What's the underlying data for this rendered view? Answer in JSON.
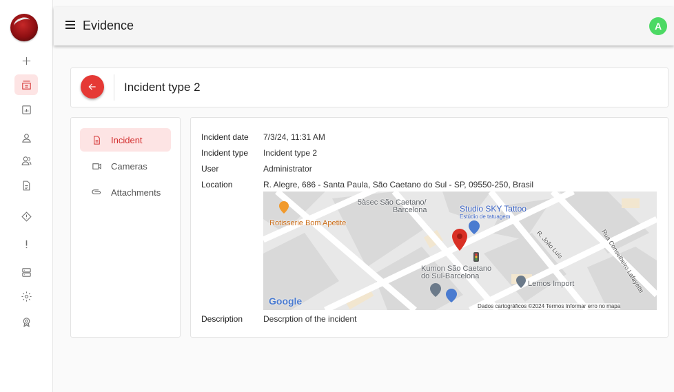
{
  "topbar": {
    "title": "Evidence",
    "avatar_letter": "A"
  },
  "header": {
    "title": "Incident type 2"
  },
  "tabs": [
    {
      "label": "Incident",
      "icon": "document-icon",
      "active": true
    },
    {
      "label": "Cameras",
      "icon": "camera-icon",
      "active": false
    },
    {
      "label": "Attachments",
      "icon": "paperclip-icon",
      "active": false
    }
  ],
  "details": {
    "date_label": "Incident date",
    "date_value": "7/3/24, 11:31 AM",
    "type_label": "Incident type",
    "type_value": "Incident type 2",
    "user_label": "User",
    "user_value": "Administrator",
    "location_label": "Location",
    "location_value": "R. Alegre, 686 - Santa Paula, São Caetano do Sul - SP, 09550-250, Brasil",
    "description_label": "Description",
    "description_value": "Descrption of the incident"
  },
  "map": {
    "poi_1_line1": "5àsec São Caetano/",
    "poi_1_line2": "Barcelona",
    "poi_2_line1": "Studio SKY Tattoo",
    "poi_2_line2": "Estúdio de tatuagem",
    "poi_3": "Rotisserie Bom Apetite",
    "poi_4_line1": "Kumon São Caetano",
    "poi_4_line2": "do Sul-Barcelona",
    "poi_5": "Lemos Import",
    "street_1": "R. João Luís",
    "street_2": "Rua Conselheiro Lafayette",
    "logo": "Google",
    "attribution": "Dados cartográficos ©2024   Termos   Informar erro no mapa"
  },
  "colors": {
    "accent": "#e53935",
    "active_bg": "#fde4e4",
    "avatar": "#4cd964"
  }
}
